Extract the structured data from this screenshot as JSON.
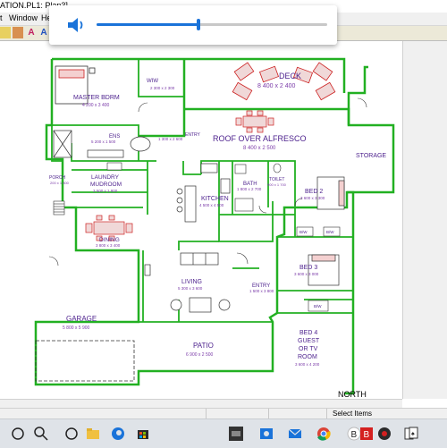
{
  "window": {
    "title": "ATION.PL1: Plan3]"
  },
  "menu": {
    "items": [
      "t",
      "Window",
      "Help"
    ]
  },
  "toolbar": {
    "letters": [
      "A",
      "A"
    ]
  },
  "volume": {
    "icon": "speaker-icon",
    "level_percent": 44,
    "accent": "#1a73d9"
  },
  "plan": {
    "colors": {
      "wall": "#22b022",
      "label": "#4b1f8c",
      "dim": "#7a3aa8",
      "line": "#333333"
    },
    "north": "NORTH",
    "rooms": {
      "deck": {
        "name": "DECK",
        "dim": "8 400 x 2 400"
      },
      "wiw": {
        "name": "WIW",
        "dim": "2 300 x 2 300"
      },
      "master": {
        "name": "MASTER BDRM",
        "dim": "4 200 x 3 400"
      },
      "entry_top": {
        "name": "ENTRY",
        "dim": "1 300 x 2 600"
      },
      "ens": {
        "name": "ENS",
        "dim": "5 200 x 1 500"
      },
      "alfresco": {
        "name": "ROOF OVER ALFRESCO",
        "dim": "8 400 x 2 500"
      },
      "storage": {
        "name": "STORAGE"
      },
      "porch": {
        "name": "PORCH",
        "dim": "200 x 1 800"
      },
      "laundry": {
        "name": "LAUNDRY",
        "name2": "MUDROOM",
        "dim": "3 500 x 1 800"
      },
      "bath": {
        "name": "BATH",
        "dim": "1 800 x 2 700"
      },
      "toilet": {
        "name": "TOILET",
        "dim": "900 x 1 700"
      },
      "bed2": {
        "name": "BED 2",
        "dim": "3 600 x 3 300"
      },
      "kitchen": {
        "name": "KITCHEN",
        "dim": "4 500 x 4 500"
      },
      "dining": {
        "name": "DINING",
        "dim": "3 800 x 3 400"
      },
      "living": {
        "name": "LIVING",
        "dim": "5 300 x 3 600"
      },
      "entry_mid": {
        "name": "ENTRY",
        "dim": "1 500 x 3 800"
      },
      "bed3": {
        "name": "BED 3",
        "dim": "3 600 x 3 000"
      },
      "bed4": {
        "name": "BED 4",
        "name2": "GUEST",
        "name3": "OR TV",
        "name4": "ROOM",
        "dim": "3 600 x 4 200"
      },
      "garage": {
        "name": "GARAGE",
        "dim": "5 800 x 5 900"
      },
      "patio": {
        "name": "PATIO",
        "dim": "6 900 x 2 500"
      }
    },
    "wardrobes": [
      "B/W",
      "B/W",
      "B/W"
    ]
  },
  "statusbar": {
    "text": "Select Items"
  },
  "taskbar": {
    "icons": [
      "windows-start-icon",
      "search-icon",
      "task-view-icon",
      "file-explorer-icon",
      "edge-icon",
      "store-icon",
      "3d-builder-icon",
      "photos-icon",
      "email-icon",
      "chrome-icon",
      "b-app-icon",
      "red-b-icon",
      "game-icon",
      "solitaire-icon"
    ]
  }
}
